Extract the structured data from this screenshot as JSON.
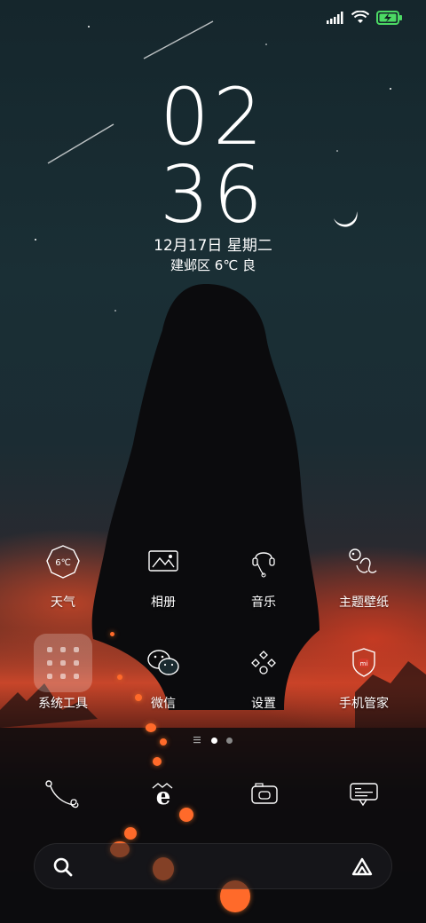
{
  "status_bar": {
    "signal_icon": "signal-icon",
    "wifi_icon": "wifi-icon",
    "battery_icon": "battery-charging-icon",
    "battery_color": "#4cd964"
  },
  "lock": {
    "hour": "02",
    "minute": "36",
    "date": "12月17日 星期二",
    "weather": "建邺区 6℃ 良"
  },
  "apps": [
    {
      "label": "天气",
      "icon": "weather-icon",
      "badge_text": "6℃"
    },
    {
      "label": "相册",
      "icon": "gallery-icon"
    },
    {
      "label": "音乐",
      "icon": "music-icon"
    },
    {
      "label": "主题壁纸",
      "icon": "themes-icon"
    },
    {
      "label": "系统工具",
      "icon": "folder-icon"
    },
    {
      "label": "微信",
      "icon": "wechat-icon"
    },
    {
      "label": "设置",
      "icon": "settings-icon"
    },
    {
      "label": "手机管家",
      "icon": "security-icon",
      "badge_text": "mi"
    }
  ],
  "page_indicator": {
    "pages": 2,
    "active": 1
  },
  "dock": [
    {
      "icon": "phone-icon"
    },
    {
      "icon": "browser-icon"
    },
    {
      "icon": "camera-icon"
    },
    {
      "icon": "messages-icon"
    }
  ],
  "search": {
    "placeholder": "",
    "search_icon": "search-icon",
    "assistant_icon": "assistant-icon"
  },
  "colors": {
    "accent_sunset": "#c8462a",
    "sky": "#1a2f35"
  }
}
